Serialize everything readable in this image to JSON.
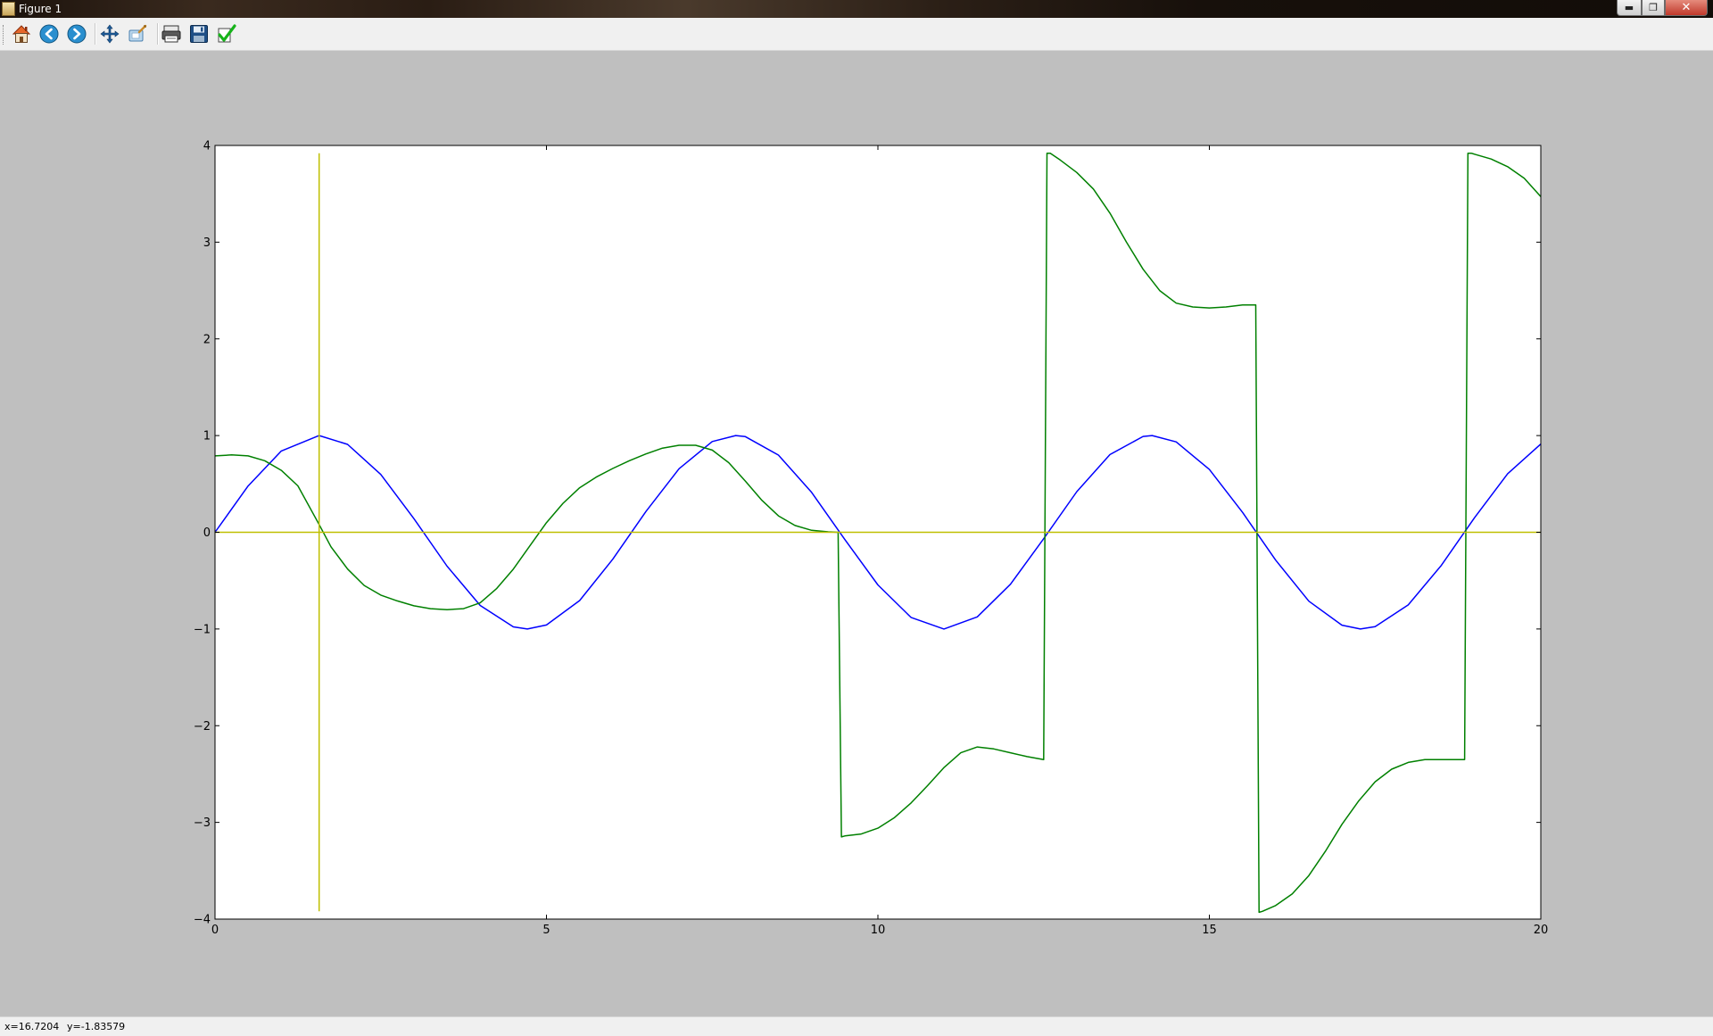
{
  "window": {
    "title": "Figure 1",
    "minimize_glyph": "▬",
    "maximize_glyph": "❐",
    "close_glyph": "✕"
  },
  "toolbar": {
    "buttons": [
      {
        "name": "home-icon"
      },
      {
        "name": "back-icon"
      },
      {
        "name": "forward-icon"
      },
      {
        "name": "pan-icon"
      },
      {
        "name": "zoom-icon"
      },
      {
        "name": "subplots-icon"
      },
      {
        "name": "save-icon"
      },
      {
        "name": "edit-check-icon"
      }
    ]
  },
  "status": {
    "x_readout": "x=16.7204",
    "y_readout": "y=-1.83579"
  },
  "chart_data": {
    "type": "line",
    "xlim": [
      0,
      20
    ],
    "ylim": [
      -4,
      4
    ],
    "xticks": [
      0,
      5,
      10,
      15,
      20
    ],
    "yticks": [
      4,
      3,
      2,
      1,
      0,
      -1,
      -2,
      -3,
      -4
    ],
    "xtick_labels": [
      "0",
      "5",
      "10",
      "15",
      "20"
    ],
    "ytick_labels": [
      "4",
      "3",
      "2",
      "1",
      "0",
      "−1",
      "−2",
      "−3",
      "−4"
    ],
    "grid": false,
    "colors": {
      "blue": "#0000ff",
      "green": "#008000",
      "yellow": "#bfbf00"
    },
    "series": [
      {
        "color": "#0000ff",
        "x": [
          0,
          0.5,
          1,
          1.5708,
          2,
          2.5,
          3,
          3.5,
          4,
          4.5,
          4.7124,
          5,
          5.5,
          6,
          6.5,
          7,
          7.5,
          7.854,
          8,
          8.5,
          9,
          9.5,
          10,
          10.5,
          10.9956,
          11.5,
          12,
          12.5,
          13,
          13.5,
          14,
          14.1372,
          14.5,
          15,
          15.5,
          16,
          16.5,
          17,
          17.2788,
          17.5,
          18,
          18.5,
          19,
          19.5,
          20
        ],
        "y": [
          0,
          0.479,
          0.841,
          1,
          0.909,
          0.598,
          0.141,
          -0.351,
          -0.757,
          -0.978,
          -1,
          -0.959,
          -0.706,
          -0.279,
          0.215,
          0.657,
          0.938,
          1,
          0.989,
          0.798,
          0.412,
          -0.075,
          -0.544,
          -0.88,
          -1,
          -0.875,
          -0.537,
          -0.066,
          0.42,
          0.804,
          0.991,
          1,
          0.935,
          0.65,
          0.206,
          -0.288,
          -0.712,
          -0.961,
          -1,
          -0.976,
          -0.751,
          -0.342,
          0.15,
          0.605,
          0.913
        ]
      },
      {
        "color": "#008000",
        "x": [
          0,
          0.25,
          0.5,
          0.75,
          1,
          1.25,
          1.5708,
          1.75,
          2,
          2.25,
          2.5,
          2.75,
          3,
          3.25,
          3.5,
          3.75,
          4,
          4.25,
          4.5,
          4.75,
          5,
          5.25,
          5.5,
          5.75,
          6,
          6.25,
          6.5,
          6.75,
          7,
          7.25,
          7.5,
          7.75,
          8,
          8.25,
          8.5,
          8.75,
          9,
          9.25,
          9.4,
          9.45,
          9.5,
          9.75,
          10,
          10.25,
          10.5,
          10.75,
          11,
          11.25,
          11.5,
          11.75,
          12,
          12.25,
          12.5,
          12.55,
          12.6,
          12.75,
          13,
          13.25,
          13.5,
          13.75,
          14,
          14.25,
          14.5,
          14.75,
          15,
          15.25,
          15.5,
          15.7,
          15.75,
          15.8,
          16,
          16.25,
          16.5,
          16.75,
          17,
          17.25,
          17.5,
          17.75,
          18,
          18.25,
          18.5,
          18.85,
          18.9,
          18.95,
          19,
          19.25,
          19.5,
          19.75,
          20
        ],
        "y": [
          0.79,
          0.8,
          0.79,
          0.74,
          0.64,
          0.48,
          0.08,
          -0.15,
          -0.38,
          -0.55,
          -0.65,
          -0.71,
          -0.76,
          -0.79,
          -0.8,
          -0.79,
          -0.73,
          -0.58,
          -0.38,
          -0.14,
          0.1,
          0.3,
          0.46,
          0.57,
          0.66,
          0.74,
          0.81,
          0.87,
          0.9,
          0.9,
          0.85,
          0.72,
          0.53,
          0.33,
          0.17,
          0.07,
          0.02,
          0.005,
          0,
          -3.15,
          -3.14,
          -3.12,
          -3.06,
          -2.95,
          -2.8,
          -2.62,
          -2.43,
          -2.28,
          -2.22,
          -2.24,
          -2.28,
          -2.32,
          -2.35,
          3.92,
          3.92,
          3.85,
          3.72,
          3.55,
          3.3,
          3.0,
          2.72,
          2.5,
          2.37,
          2.33,
          2.32,
          2.33,
          2.35,
          2.35,
          -3.93,
          -3.92,
          -3.86,
          -3.74,
          -3.55,
          -3.3,
          -3.02,
          -2.78,
          -2.58,
          -2.45,
          -2.38,
          -2.35,
          -2.35,
          -2.35,
          3.92,
          3.92,
          3.91,
          3.86,
          3.78,
          3.66,
          3.47
        ]
      },
      {
        "color": "#bfbf00",
        "x": [
          0,
          20
        ],
        "y": [
          0,
          0
        ]
      },
      {
        "color": "#bfbf00",
        "x": [
          1.5708,
          1.5708
        ],
        "y": [
          -3.92,
          3.92
        ]
      }
    ]
  }
}
